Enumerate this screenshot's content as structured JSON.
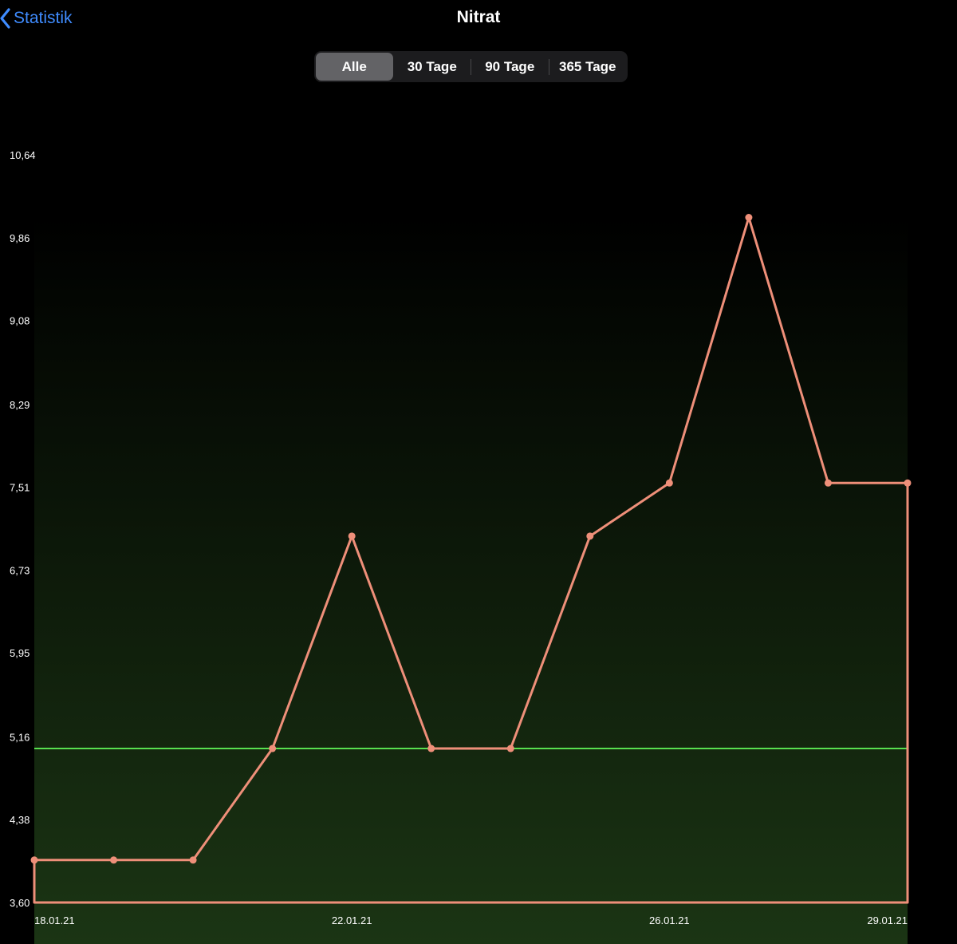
{
  "nav": {
    "back_label": "Statistik",
    "title": "Nitrat"
  },
  "range_selector": {
    "options": [
      "Alle",
      "30 Tage",
      "90 Tage",
      "365 Tage"
    ],
    "selected": "Alle"
  },
  "colors": {
    "background": "#000000",
    "accent": "#3f8cff",
    "series_line": "#ee8f79",
    "reference_line": "#58e04f",
    "gradient_bottom": "#1b3514"
  },
  "icons": {
    "back": "chevron-left-icon"
  },
  "chart_data": {
    "type": "line",
    "title": "Nitrat",
    "xlabel": "",
    "ylabel": "",
    "x_tick_labels": [
      "18.01.21",
      "22.01.21",
      "26.01.21",
      "29.01.21"
    ],
    "x_ticks": [
      0,
      4,
      8,
      11
    ],
    "y_tick_labels": [
      "3,60",
      "4,38",
      "5,16",
      "5,95",
      "6,73",
      "7,51",
      "8,29",
      "9,08",
      "9,86",
      "10,64"
    ],
    "y_ticks": [
      3.6,
      4.38,
      5.16,
      5.95,
      6.73,
      7.51,
      8.29,
      9.08,
      9.86,
      10.64
    ],
    "ylim": [
      3.6,
      10.64
    ],
    "xlim": [
      0,
      11
    ],
    "grid": false,
    "fill": "gradient-green",
    "reference_line": 5.05,
    "series": [
      {
        "x": [
          0,
          1,
          2,
          3,
          4,
          5,
          6,
          7,
          8,
          9,
          10,
          11
        ],
        "values": [
          4.0,
          4.0,
          4.0,
          5.05,
          7.05,
          5.05,
          5.05,
          7.05,
          7.55,
          10.05,
          7.55,
          7.55
        ]
      }
    ]
  }
}
